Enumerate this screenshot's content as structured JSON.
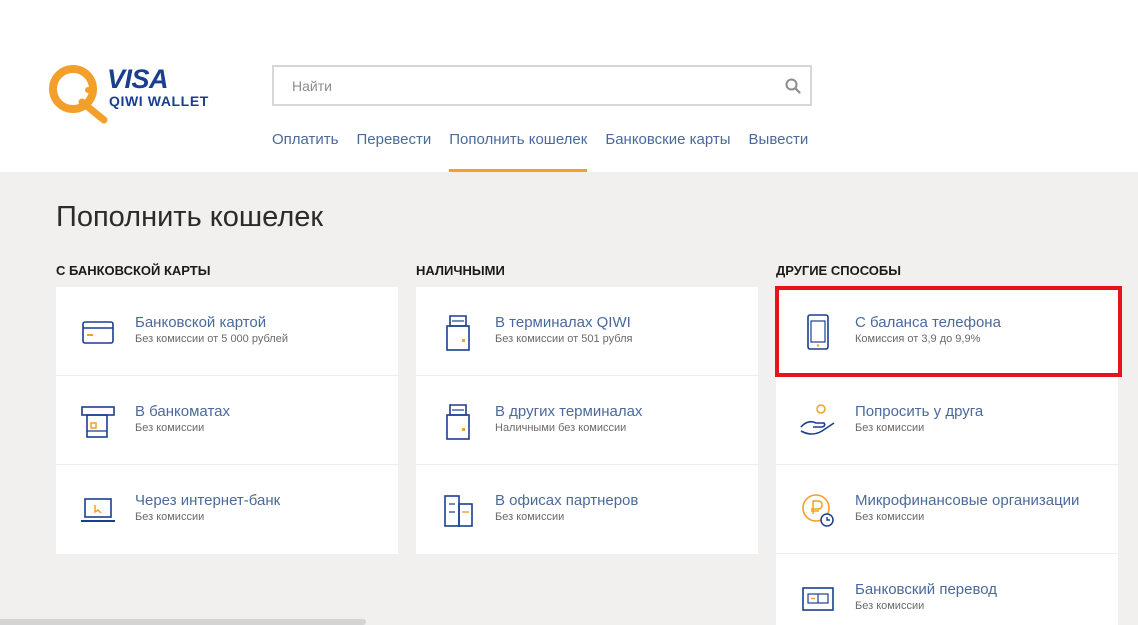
{
  "header": {
    "logo": {
      "visa": "VISA",
      "wallet": "QIWI WALLET"
    },
    "search": {
      "placeholder": "Найти",
      "value": ""
    },
    "nav": [
      {
        "label": "Оплатить",
        "active": false
      },
      {
        "label": "Перевести",
        "active": false
      },
      {
        "label": "Пополнить кошелек",
        "active": true
      },
      {
        "label": "Банковские карты",
        "active": false
      },
      {
        "label": "Вывести",
        "active": false
      }
    ]
  },
  "page": {
    "title": "Пополнить кошелек"
  },
  "columns": [
    {
      "title": "С БАНКОВСКОЙ КАРТЫ",
      "items": [
        {
          "icon": "bank-card-icon",
          "title": "Банковской картой",
          "subtitle": "Без комиссии от 5 000 рублей"
        },
        {
          "icon": "atm-icon",
          "title": "В банкоматах",
          "subtitle": "Без комиссии"
        },
        {
          "icon": "laptop-icon",
          "title": "Через интернет-банк",
          "subtitle": "Без комиссии"
        }
      ]
    },
    {
      "title": "НАЛИЧНЫМИ",
      "items": [
        {
          "icon": "terminal-icon",
          "title": "В терминалах QIWI",
          "subtitle": "Без комиссии от 501 рубля"
        },
        {
          "icon": "terminal-icon",
          "title": "В других терминалах",
          "subtitle": "Наличными без комиссии"
        },
        {
          "icon": "office-building-icon",
          "title": "В офисах партнеров",
          "subtitle": "Без комиссии"
        }
      ]
    },
    {
      "title": "ДРУГИЕ СПОСОБЫ",
      "items": [
        {
          "icon": "mobile-phone-icon",
          "title": "С баланса телефона",
          "subtitle": "Комиссия от 3,9 до 9,9%"
        },
        {
          "icon": "hand-coin-icon",
          "title": "Попросить у друга",
          "subtitle": "Без комиссии"
        },
        {
          "icon": "ruble-clock-icon",
          "title": "Микрофинансовые организации",
          "subtitle": "Без комиссии"
        },
        {
          "icon": "bank-transfer-icon",
          "title": "Банковский перевод",
          "subtitle": "Без комиссии"
        }
      ]
    }
  ],
  "colors": {
    "brand_blue": "#1a3f8f",
    "link_blue": "#4b6a9b",
    "accent_orange": "#f2a02b",
    "highlight_red": "#e5131c"
  }
}
